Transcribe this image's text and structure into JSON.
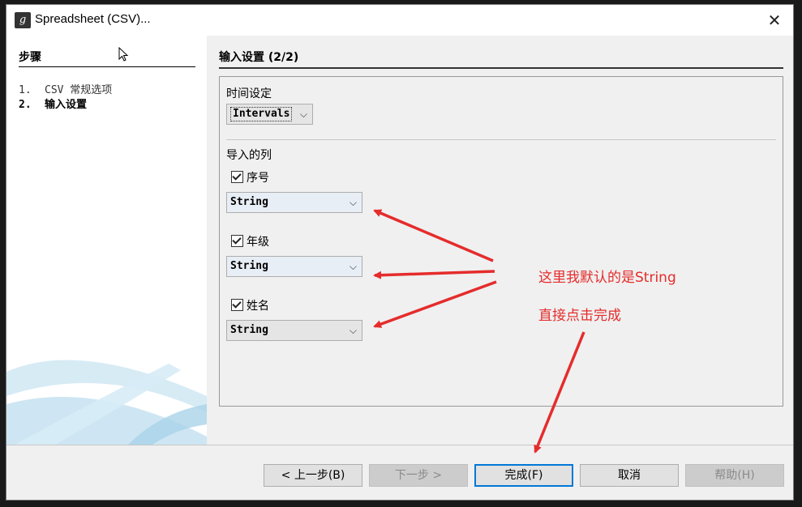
{
  "window": {
    "title": "Spreadsheet (CSV)...",
    "close_glyph": "✕"
  },
  "steps": {
    "header": "步骤",
    "items": [
      {
        "num": "1.",
        "label": "CSV 常规选项"
      },
      {
        "num": "2.",
        "label": "输入设置"
      }
    ]
  },
  "page": {
    "title": "输入设置 (2/2)",
    "time_setting": {
      "label": "时间设定",
      "value": "Intervals"
    },
    "columns_label": "导入的列",
    "columns": [
      {
        "name": "序号",
        "checked": true,
        "type": "String"
      },
      {
        "name": "年级",
        "checked": true,
        "type": "String"
      },
      {
        "name": "姓名",
        "checked": true,
        "type": "String"
      }
    ]
  },
  "buttons": {
    "back": "< 上一步(B)",
    "next": "下一步 >",
    "finish": "完成(F)",
    "cancel": "取消",
    "help": "帮助(H)"
  },
  "annotations": {
    "note1": "这里我默认的是String",
    "note2": "直接点击完成",
    "color": "#e52c2c"
  }
}
